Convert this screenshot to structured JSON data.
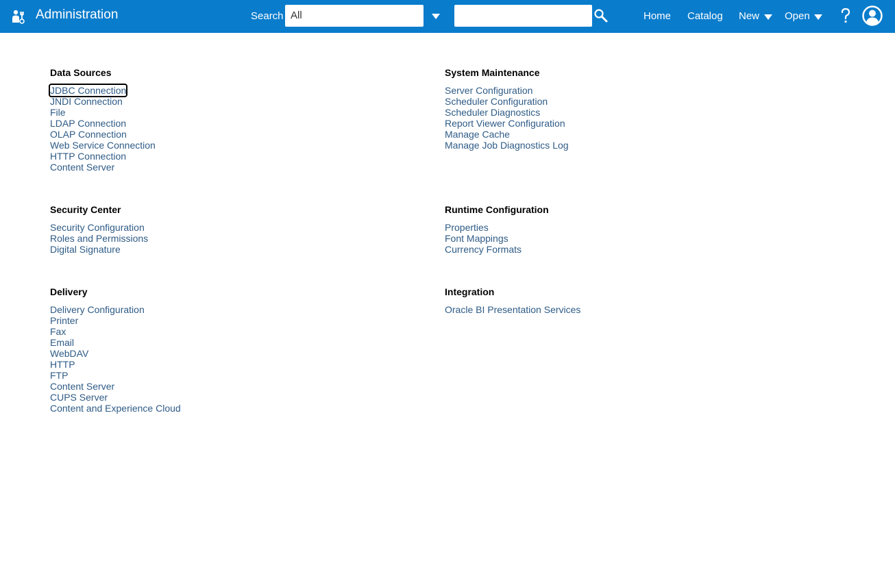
{
  "header": {
    "title": "Administration",
    "app_icon": "admin-tools-icon",
    "search_label": "Search",
    "search_scope": "All",
    "search_placeholder": "",
    "nav": {
      "home": "Home",
      "catalog": "Catalog",
      "new": "New",
      "open": "Open"
    },
    "help": "?",
    "colors": {
      "bar": "#0a7ccc",
      "link": "#2e5b86"
    }
  },
  "sections": {
    "data_sources": {
      "title": "Data Sources",
      "items": [
        "JDBC Connection",
        "JNDI Connection",
        "File",
        "LDAP Connection",
        "OLAP Connection",
        "Web Service Connection",
        "HTTP Connection",
        "Content Server"
      ]
    },
    "system_maintenance": {
      "title": "System Maintenance",
      "items": [
        "Server Configuration",
        "Scheduler Configuration",
        "Scheduler Diagnostics",
        "Report Viewer Configuration",
        "Manage Cache",
        "Manage Job Diagnostics Log"
      ]
    },
    "security_center": {
      "title": "Security Center",
      "items": [
        "Security Configuration",
        "Roles and Permissions",
        "Digital Signature"
      ]
    },
    "runtime_configuration": {
      "title": "Runtime Configuration",
      "items": [
        "Properties",
        "Font Mappings",
        "Currency Formats"
      ]
    },
    "delivery": {
      "title": "Delivery",
      "items": [
        "Delivery Configuration",
        "Printer",
        "Fax",
        "Email",
        "WebDAV",
        "HTTP",
        "FTP",
        "Content Server",
        "CUPS Server",
        "Content and Experience Cloud"
      ]
    },
    "integration": {
      "title": "Integration",
      "items": [
        "Oracle BI Presentation Services"
      ]
    }
  }
}
